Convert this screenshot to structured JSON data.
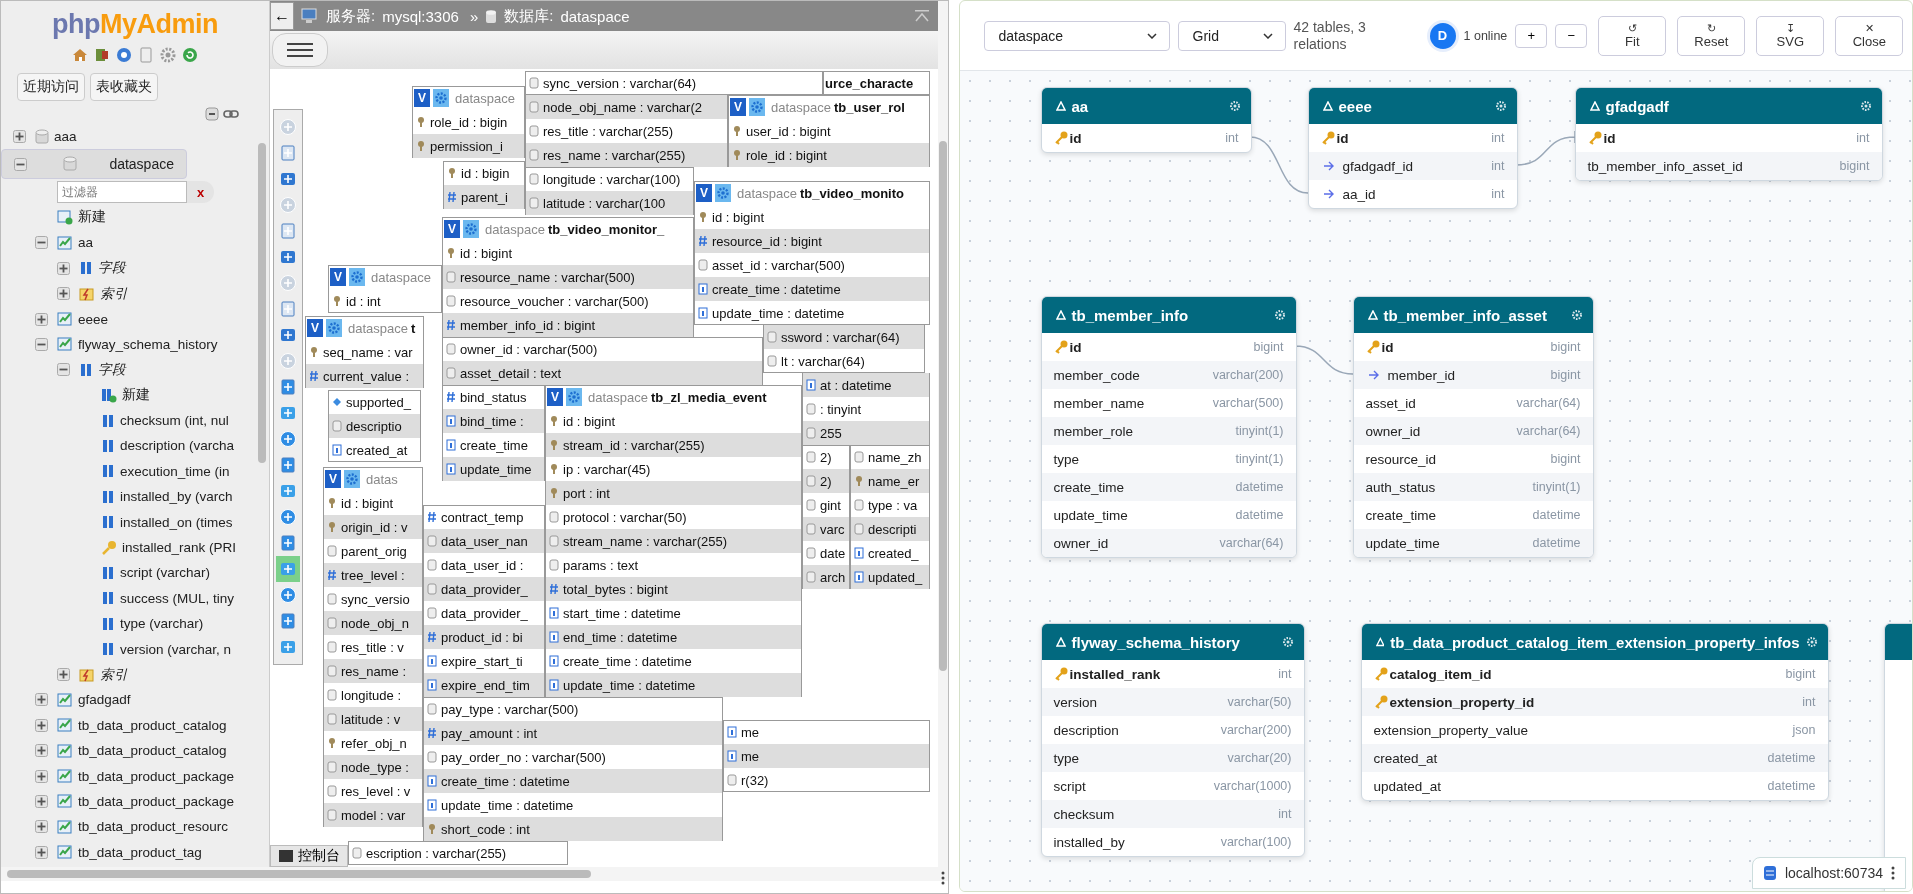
{
  "sidebar": {
    "logo": [
      "php",
      "MyAdmin"
    ],
    "buttons": [
      "近期访问",
      "表收藏夹"
    ],
    "tree": [
      {
        "label": "aaa",
        "kind": "db",
        "expanded": false
      },
      {
        "label": "dataspace",
        "kind": "db",
        "expanded": true,
        "children": [
          {
            "kind": "filter",
            "placeholder": "过滤器",
            "clear": "x"
          },
          {
            "label": "新建",
            "kind": "new"
          },
          {
            "label": "aa",
            "kind": "table",
            "expanded": true,
            "children": [
              {
                "label": "字段",
                "kind": "columns",
                "expanded": false
              },
              {
                "label": "索引",
                "kind": "indexes",
                "expanded": false
              }
            ]
          },
          {
            "label": "eeee",
            "kind": "table",
            "expanded": false
          },
          {
            "label": "flyway_schema_history",
            "kind": "table",
            "expanded": true,
            "children": [
              {
                "label": "字段",
                "kind": "columns",
                "expanded": true,
                "children": [
                  {
                    "label": "新建",
                    "kind": "newcol"
                  },
                  {
                    "label": "checksum (int, nul",
                    "kind": "column"
                  },
                  {
                    "label": "description (varcha",
                    "kind": "column"
                  },
                  {
                    "label": "execution_time (in",
                    "kind": "column"
                  },
                  {
                    "label": "installed_by (varch",
                    "kind": "column"
                  },
                  {
                    "label": "installed_on (times",
                    "kind": "column"
                  },
                  {
                    "label": "installed_rank (PRI",
                    "kind": "key"
                  },
                  {
                    "label": "script (varchar)",
                    "kind": "column"
                  },
                  {
                    "label": "success (MUL, tiny",
                    "kind": "column"
                  },
                  {
                    "label": "type (varchar)",
                    "kind": "column"
                  },
                  {
                    "label": "version (varchar, n",
                    "kind": "column"
                  }
                ]
              },
              {
                "label": "索引",
                "kind": "indexes",
                "expanded": false
              }
            ]
          },
          {
            "label": "gfadgadf",
            "kind": "table",
            "expanded": false
          },
          {
            "label": "tb_data_product_catalog",
            "kind": "table",
            "expanded": false
          },
          {
            "label": "tb_data_product_catalog",
            "kind": "table",
            "expanded": false
          },
          {
            "label": "tb_data_product_package",
            "kind": "table",
            "expanded": false
          },
          {
            "label": "tb_data_product_package",
            "kind": "table",
            "expanded": false
          },
          {
            "label": "tb_data_product_resourc",
            "kind": "table",
            "expanded": false
          },
          {
            "label": "tb_data_product_tag",
            "kind": "table",
            "expanded": false
          }
        ]
      }
    ]
  },
  "breadcrumb": {
    "back": "←",
    "server_label": "服务器:",
    "server": "mysql:3306",
    "separator": "»",
    "database_label": "数据库:",
    "database": "dataspace"
  },
  "designer_toolbar": [
    {
      "selected": false
    },
    {
      "selected": false
    },
    {
      "selected": false
    },
    {
      "selected": false
    },
    {
      "selected": false
    },
    {
      "selected": false
    },
    {
      "selected": false
    },
    {
      "selected": false
    },
    {
      "selected": false
    },
    {
      "selected": false
    },
    {
      "selected": false
    },
    {
      "selected": false
    },
    {
      "selected": false
    },
    {
      "selected": false
    },
    {
      "selected": false
    },
    {
      "selected": false
    },
    {
      "selected": false
    },
    {
      "selected": true
    },
    {
      "selected": false
    },
    {
      "selected": false
    },
    {
      "selected": false
    }
  ],
  "designer_tables": [
    {
      "header": {
        "name": "urce_characte"
      }
    },
    {
      "header": {
        "toggle": "V",
        "database": "dataspace"
      },
      "fields": [
        {
          "text": "role_id : bigin",
          "kind": "key"
        },
        {
          "text": "permission_i",
          "kind": "key"
        }
      ]
    },
    {
      "fields": [
        {
          "text": "sync_version : varchar(64)",
          "kind": "text"
        }
      ]
    },
    {
      "fields": [
        {
          "text": "node_obj_name : varchar(2",
          "kind": "text"
        },
        {
          "text": "res_title : varchar(255)",
          "kind": "text"
        },
        {
          "text": "res_name : varchar(255)",
          "kind": "text"
        }
      ]
    },
    {
      "fields": [
        {
          "text": "longitude : varchar(100)",
          "kind": "text"
        },
        {
          "text": "latitude : varchar(100",
          "kind": "text"
        }
      ]
    },
    {
      "header": {
        "toggle": "V",
        "database": "dataspace",
        "name": "tb_user_rol"
      },
      "fields": [
        {
          "text": "user_id : bigint",
          "kind": "key"
        },
        {
          "text": "role_id : bigint",
          "kind": "key"
        }
      ]
    },
    {
      "fields": [
        {
          "text": "id : bigin",
          "kind": "key"
        },
        {
          "text": "parent_i",
          "kind": "hash"
        }
      ]
    },
    {
      "header": {
        "toggle": "V",
        "database": "dataspace"
      },
      "fields": [
        {
          "text": "id : int",
          "kind": "key"
        }
      ]
    },
    {
      "header": {
        "toggle": "V",
        "database": "dataspace",
        "name": "t"
      },
      "fields": [
        {
          "text": "seq_name : var",
          "kind": "key"
        },
        {
          "text": "current_value :",
          "kind": "hash"
        }
      ]
    },
    {
      "fields": [
        {
          "text": "supported_",
          "kind": "diamond"
        },
        {
          "text": "descriptio",
          "kind": "text"
        },
        {
          "text": "created_at",
          "kind": "date"
        }
      ]
    },
    {
      "header": {
        "toggle": "V",
        "database": "datas"
      },
      "fields": [
        {
          "text": "id : bigint",
          "kind": "key"
        },
        {
          "text": "origin_id : v",
          "kind": "key"
        },
        {
          "text": "parent_orig",
          "kind": "text"
        },
        {
          "text": "tree_level :",
          "kind": "hash"
        },
        {
          "text": "sync_versio",
          "kind": "text"
        },
        {
          "text": "node_obj_n",
          "kind": "text"
        },
        {
          "text": "res_title : v",
          "kind": "text"
        },
        {
          "text": "res_name :",
          "kind": "text"
        },
        {
          "text": "longitude :",
          "kind": "text"
        },
        {
          "text": "latitude : v",
          "kind": "text"
        },
        {
          "text": "refer_obj_n",
          "kind": "key"
        },
        {
          "text": "node_type :",
          "kind": "text"
        },
        {
          "text": "res_level : v",
          "kind": "text"
        },
        {
          "text": "model : var",
          "kind": "text"
        }
      ]
    },
    {
      "header": {
        "toggle": "V",
        "database": "dataspace",
        "name": "tb_video_monito"
      },
      "fields": [
        {
          "text": "id : bigint",
          "kind": "key"
        },
        {
          "text": "resource_id : bigint",
          "kind": "hash"
        },
        {
          "text": "asset_id : varchar(500)",
          "kind": "text"
        },
        {
          "text": "create_time : datetime",
          "kind": "date"
        },
        {
          "text": "update_time : datetime",
          "kind": "date"
        }
      ]
    },
    {
      "header": {
        "toggle": "V",
        "database": "dataspace",
        "name": "tb_video_monitor_"
      },
      "fields": [
        {
          "text": "id : bigint",
          "kind": "key"
        },
        {
          "text": "resource_name : varchar(500)",
          "kind": "text"
        },
        {
          "text": "resource_voucher : varchar(500)",
          "kind": "text"
        },
        {
          "text": "member_info_id : bigint",
          "kind": "hash"
        }
      ]
    },
    {
      "fields": [
        {
          "text": "owner_id : varchar(500)",
          "kind": "text"
        },
        {
          "text": "asset_detail : text",
          "kind": "text"
        }
      ]
    },
    {
      "fields": [
        {
          "text": "bind_status",
          "kind": "hash"
        },
        {
          "text": "bind_time :",
          "kind": "date"
        },
        {
          "text": "create_time",
          "kind": "date"
        },
        {
          "text": "update_time",
          "kind": "date"
        }
      ]
    },
    {
      "fields": [
        {
          "text": "ssword : varchar(64)",
          "kind": "text"
        },
        {
          "text": "lt : varchar(64)",
          "kind": "text"
        }
      ]
    },
    {
      "fields": [
        {
          "text": "at : datetime",
          "kind": "date"
        },
        {
          "text": ": tinyint",
          "kind": "text"
        },
        {
          "text": "255",
          "kind": "text"
        }
      ]
    },
    {
      "fields": [
        {
          "text": "2)",
          "kind": "text"
        },
        {
          "text": "2)",
          "kind": "text"
        },
        {
          "text": "gint",
          "kind": "text"
        },
        {
          "text": "varc",
          "kind": "text"
        },
        {
          "text": "date",
          "kind": "text"
        },
        {
          "text": "arch",
          "kind": "text"
        }
      ]
    },
    {
      "fields": [
        {
          "text": "name_zh",
          "kind": "text"
        },
        {
          "text": "name_er",
          "kind": "key"
        },
        {
          "text": "type : va",
          "kind": "text"
        },
        {
          "text": "descripti",
          "kind": "text"
        },
        {
          "text": "created_",
          "kind": "date"
        },
        {
          "text": "updated_",
          "kind": "date"
        }
      ]
    },
    {
      "fields": [
        {
          "text": "contract_temp",
          "kind": "hash"
        },
        {
          "text": "data_user_nan",
          "kind": "text"
        },
        {
          "text": "data_user_id :",
          "kind": "text"
        },
        {
          "text": "data_provider_",
          "kind": "text"
        },
        {
          "text": "data_provider_",
          "kind": "text"
        },
        {
          "text": "product_id : bi",
          "kind": "hash"
        },
        {
          "text": "expire_start_ti",
          "kind": "date"
        },
        {
          "text": "expire_end_tim",
          "kind": "date"
        }
      ]
    },
    {
      "header": {
        "toggle": "V",
        "database": "dataspace",
        "name": "tb_zl_media_event"
      },
      "fields": [
        {
          "text": "id : bigint",
          "kind": "key"
        },
        {
          "text": "stream_id : varchar(255)",
          "kind": "key"
        },
        {
          "text": "ip : varchar(45)",
          "kind": "key"
        },
        {
          "text": "port : int",
          "kind": "key"
        },
        {
          "text": "protocol : varchar(50)",
          "kind": "text"
        },
        {
          "text": "stream_name : varchar(255)",
          "kind": "text"
        },
        {
          "text": "params : text",
          "kind": "text"
        },
        {
          "text": "total_bytes : bigint",
          "kind": "hash"
        },
        {
          "text": "start_time : datetime",
          "kind": "date"
        },
        {
          "text": "end_time : datetime",
          "kind": "date"
        },
        {
          "text": "create_time : datetime",
          "kind": "date"
        },
        {
          "text": "update_time : datetime",
          "kind": "date"
        }
      ]
    },
    {
      "fields": [
        {
          "text": "pay_type : varchar(500)",
          "kind": "text"
        },
        {
          "text": "pay_amount : int",
          "kind": "hash"
        },
        {
          "text": "pay_order_no : varchar(500)",
          "kind": "text"
        },
        {
          "text": "create_time : datetime",
          "kind": "date"
        },
        {
          "text": "update_time : datetime",
          "kind": "date"
        },
        {
          "text": "short_code : int",
          "kind": "key"
        }
      ]
    },
    {
      "fields": [
        {
          "text": "me",
          "kind": "date"
        },
        {
          "text": "me",
          "kind": "date"
        },
        {
          "text": "r(32)",
          "kind": "text"
        }
      ]
    },
    {
      "fields": [
        {
          "text": "escription : varchar(255)",
          "kind": "text"
        }
      ]
    }
  ],
  "console": "控制台",
  "erd": {
    "toolbar": {
      "database": "dataspace",
      "layout": "Grid",
      "summary": "42 tables, 3 relations",
      "avatar": "D",
      "online": "1 online",
      "zoom_in": "+",
      "zoom_out": "−",
      "buttons": [
        {
          "icon": "↺",
          "label": "Fit"
        },
        {
          "icon": "↻",
          "label": "Reset"
        },
        {
          "icon": "↧",
          "label": "SVG"
        },
        {
          "icon": "✕",
          "label": "Close"
        }
      ]
    },
    "tables": [
      {
        "name": "aa",
        "columns": [
          {
            "name": "id",
            "type": "int",
            "kind": "pk"
          }
        ]
      },
      {
        "name": "eeee",
        "columns": [
          {
            "name": "id",
            "type": "int",
            "kind": "pk"
          },
          {
            "name": "gfadgadf_id",
            "type": "int",
            "kind": "fk"
          },
          {
            "name": "aa_id",
            "type": "int",
            "kind": "fk"
          }
        ]
      },
      {
        "name": "gfadgadf",
        "columns": [
          {
            "name": "id",
            "type": "int",
            "kind": "pk"
          },
          {
            "name": "tb_member_info_asset_id",
            "type": "bigint",
            "kind": "plain"
          }
        ]
      },
      {
        "name": "tb_member_info",
        "columns": [
          {
            "name": "id",
            "type": "bigint",
            "kind": "pk"
          },
          {
            "name": "member_code",
            "type": "varchar(200)",
            "kind": "plain"
          },
          {
            "name": "member_name",
            "type": "varchar(500)",
            "kind": "plain"
          },
          {
            "name": "member_role",
            "type": "tinyint(1)",
            "kind": "plain"
          },
          {
            "name": "type",
            "type": "tinyint(1)",
            "kind": "plain"
          },
          {
            "name": "create_time",
            "type": "datetime",
            "kind": "plain"
          },
          {
            "name": "update_time",
            "type": "datetime",
            "kind": "plain"
          },
          {
            "name": "owner_id",
            "type": "varchar(64)",
            "kind": "plain"
          }
        ]
      },
      {
        "name": "tb_member_info_asset",
        "columns": [
          {
            "name": "id",
            "type": "bigint",
            "kind": "pk"
          },
          {
            "name": "member_id",
            "type": "bigint",
            "kind": "fk"
          },
          {
            "name": "asset_id",
            "type": "varchar(64)",
            "kind": "plain"
          },
          {
            "name": "owner_id",
            "type": "varchar(64)",
            "kind": "plain"
          },
          {
            "name": "resource_id",
            "type": "bigint",
            "kind": "plain"
          },
          {
            "name": "auth_status",
            "type": "tinyint(1)",
            "kind": "plain"
          },
          {
            "name": "create_time",
            "type": "datetime",
            "kind": "plain"
          },
          {
            "name": "update_time",
            "type": "datetime",
            "kind": "plain"
          }
        ]
      },
      {
        "name": "flyway_schema_history",
        "columns": [
          {
            "name": "installed_rank",
            "type": "int",
            "kind": "pk"
          },
          {
            "name": "version",
            "type": "varchar(50)",
            "kind": "plain"
          },
          {
            "name": "description",
            "type": "varchar(200)",
            "kind": "plain"
          },
          {
            "name": "type",
            "type": "varchar(20)",
            "kind": "plain"
          },
          {
            "name": "script",
            "type": "varchar(1000)",
            "kind": "plain"
          },
          {
            "name": "checksum",
            "type": "int",
            "kind": "plain"
          },
          {
            "name": "installed_by",
            "type": "varchar(100)",
            "kind": "plain"
          }
        ]
      },
      {
        "name": "tb_data_product_catalog_item_extension_property_infos",
        "columns": [
          {
            "name": "catalog_item_id",
            "type": "bigint",
            "kind": "pk"
          },
          {
            "name": "extension_property_id",
            "type": "int",
            "kind": "pk"
          },
          {
            "name": "extension_property_value",
            "type": "json",
            "kind": "plain"
          },
          {
            "name": "created_at",
            "type": "datetime",
            "kind": "plain"
          },
          {
            "name": "updated_at",
            "type": "datetime",
            "kind": "plain"
          }
        ]
      }
    ],
    "status": "localhost:60734"
  }
}
